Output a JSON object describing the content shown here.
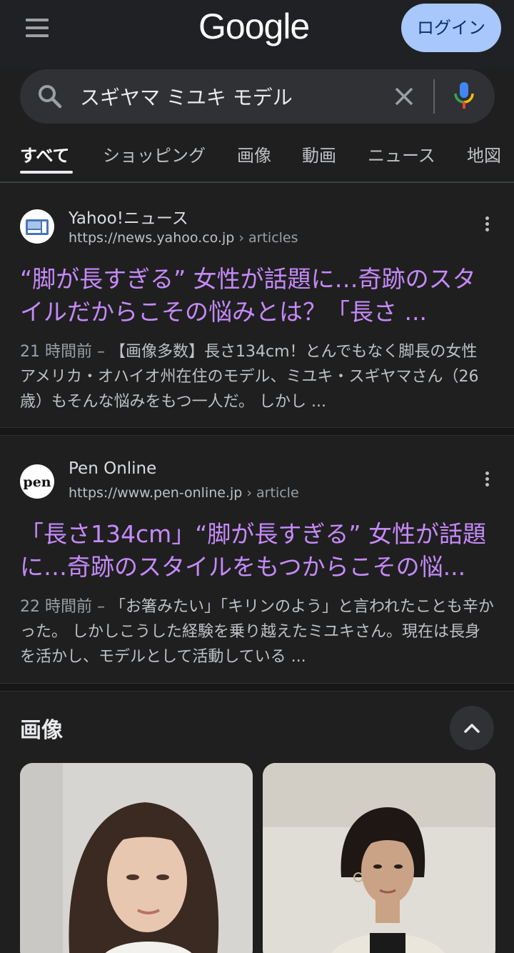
{
  "header": {
    "logo": "Google",
    "login_label": "ログイン"
  },
  "search": {
    "query": "スギヤマ ミユキ モデル"
  },
  "tabs": [
    {
      "label": "すべて",
      "active": true
    },
    {
      "label": "ショッピング",
      "active": false
    },
    {
      "label": "画像",
      "active": false
    },
    {
      "label": "動画",
      "active": false
    },
    {
      "label": "ニュース",
      "active": false
    },
    {
      "label": "地図",
      "active": false
    }
  ],
  "results": [
    {
      "site_name": "Yahoo!ニュース",
      "url": "https://news.yahoo.co.jp",
      "crumb": " › articles",
      "title": "“脚が長すぎる” 女性が話題に…奇跡のスタイルだからこその悩みとは？「長さ ...",
      "date": "21 時間前 –",
      "snippet": " 【画像多数】長さ134cm！とんでもなく脚長の女性 アメリカ・オハイオ州在住のモデル、ミユキ・スギヤマさん（26歳）もそんな悩みをもつ一人だ。 しかし ..."
    },
    {
      "site_name": "Pen Online",
      "url": "https://www.pen-online.jp",
      "crumb": " › article",
      "title": "「長さ134cm」“脚が長すぎる” 女性が話題に…奇跡のスタイルをもつからこその悩...",
      "date": "22 時間前 –",
      "snippet": " 「お箸みたい」「キリンのよう」と言われたことも辛かった。 しかしこうした経験を乗り越えたミユキさん。現在は長身を活かし、モデルとして活動している ..."
    }
  ],
  "images_section": {
    "heading": "画像"
  },
  "favicons": {
    "pen_text": "pen"
  }
}
